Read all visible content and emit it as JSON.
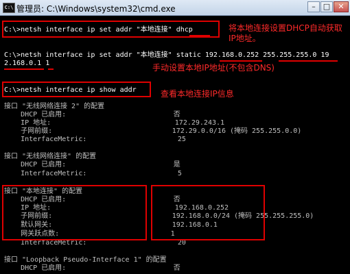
{
  "window": {
    "title": "管理员: C:\\Windows\\system32\\cmd.exe",
    "minimize": "–",
    "maximize": "□",
    "close": "✕"
  },
  "lines": {
    "cmd1": "C:\\>netsh interface ip set addr \"本地连接\" dhcp",
    "cmd2a": "C:\\>netsh interface ip set addr \"本地连接\" static 192.168.0.252 255.255.255.0 19",
    "cmd2b": "2.168.0.1 1",
    "cmd3": "C:\\>netsh interface ip show addr",
    "if1": "接口 \"无线网络连接 2\" 的配置",
    "if1_dhcp": "    DHCP 已启用:                          否",
    "if1_ip": "    IP 地址:                              172.29.243.1",
    "if1_mask": "    子网前缀:                             172.29.0.0/16 (掩码 255.255.0.0)",
    "if1_metric": "    InterfaceMetric:                      25",
    "if2": "接口 \"无线网络连接\" 的配置",
    "if2_dhcp": "    DHCP 已启用:                          是",
    "if2_metric": "    InterfaceMetric:                      5",
    "if3": "接口 \"本地连接\" 的配置",
    "if3_dhcp": "    DHCP 已启用:                          否",
    "if3_ip": "    IP 地址:                              192.168.0.252",
    "if3_mask": "    子网前缀:                             192.168.0.0/24 (掩码 255.255.255.0)",
    "if3_gw": "    默认网关:                             192.168.0.1",
    "if3_hops": "    网关跃点数:                           1",
    "if3_metric": "    InterfaceMetric:                      20",
    "if4": "接口 \"Loopback Pseudo-Interface 1\" 的配置",
    "if4_dhcp": "    DHCP 已启用:                          否"
  },
  "annotations": {
    "note1a": "将本地连接设置DHCP自动获取",
    "note1b": "IP地址。",
    "note2": "手动设置本地IP地址(不包含DNS)",
    "note3": "查看本地连接IP信息"
  },
  "colors": {
    "annotation": "#ff2a2a",
    "highlight_box": "#e00000",
    "console_bg": "#000000",
    "console_text": "#c0c0c0"
  }
}
